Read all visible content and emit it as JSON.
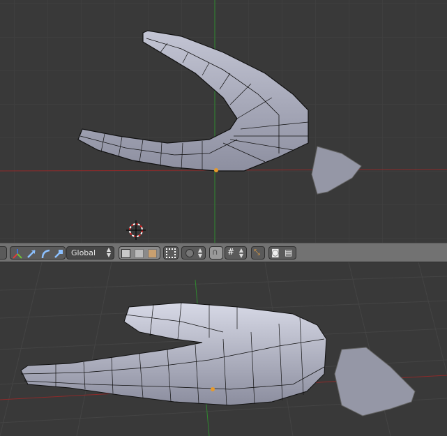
{
  "app": "Blender 3D View",
  "toolbar": {
    "transform_orientation": "Global",
    "icons": [
      "manipulator-axis-icon",
      "translate-icon",
      "rotate-icon",
      "scale-icon",
      "vertex-select-icon",
      "edge-select-icon",
      "face-select-icon",
      "limit-selection-icon",
      "proportional-edit-icon",
      "snap-magnet-icon",
      "snap-target-icon",
      "opengl-render-icon",
      "render-still-icon",
      "render-animation-icon"
    ]
  },
  "colors": {
    "viewport_bg": "#393939",
    "grid": "#444444",
    "x_axis": "#8e2a2a",
    "y_axis": "#2f8a2f",
    "mesh": "#a9abbd",
    "toolbar": "#727272"
  }
}
